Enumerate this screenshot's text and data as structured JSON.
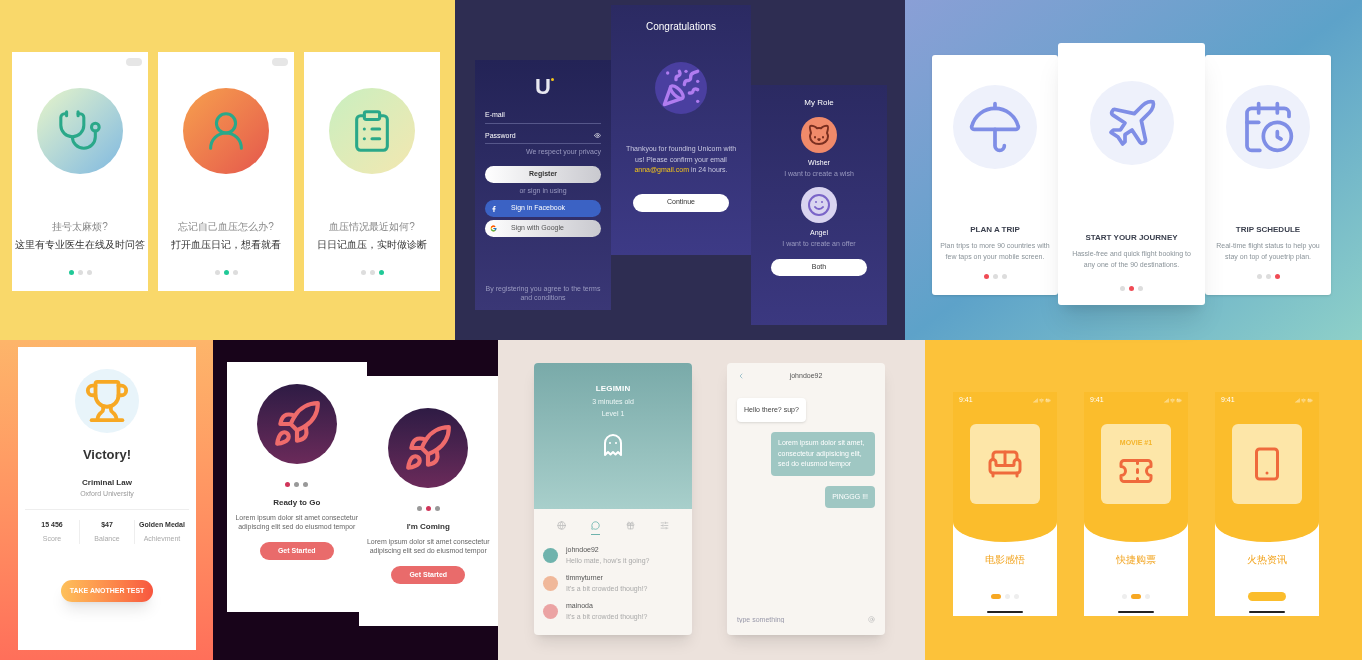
{
  "health": {
    "screens": [
      {
        "skip_button": true,
        "question": "挂号太麻烦?",
        "answer": "这里有专业医生在线及时问答",
        "dots": [
          {
            "selected": true
          },
          {
            "selected": false
          },
          {
            "selected": false
          }
        ]
      },
      {
        "skip_button": true,
        "question": "忘记自己血压怎么办?",
        "answer": "打开血压日记，想看就看",
        "dots": [
          {
            "selected": false
          },
          {
            "selected": true
          },
          {
            "selected": false
          }
        ]
      },
      {
        "skip_button": false,
        "question": "血压情况最近如何?",
        "answer": "日日记血压，实时做诊断",
        "dots": [
          {
            "selected": false
          },
          {
            "selected": false
          },
          {
            "selected": true
          }
        ]
      }
    ]
  },
  "unicorn": {
    "login": {
      "logo": "U",
      "email_label": "E-mail",
      "password_label": "Password",
      "privacy_note": "We respect your privacy",
      "register_button": "Register",
      "alt_sign_in": "or sign in using",
      "facebook_button": "Sign in Facebook",
      "google_button": "Sign with Google",
      "terms": "By registering you agree to the terms and conditions"
    },
    "congrats": {
      "title": "Congratulations",
      "message": "Thankyou for founding Unicorn with us! Please confirm your email",
      "email": "anna@gmail.com",
      "deadline": "in 24 hours.",
      "continue_button": "Continue"
    },
    "role": {
      "title": "My Role",
      "roles": [
        {
          "name": "Wisher",
          "description": "I want to create a wish"
        },
        {
          "name": "Angel",
          "description": "I want to create an offer"
        }
      ],
      "both_button": "Both"
    }
  },
  "travel": {
    "cards": [
      {
        "featured": false,
        "title": "PLAN A TRIP",
        "description": "Plan trips to more 90 countries with few taps on your mobile screen.",
        "dots": [
          {
            "selected": true
          },
          {
            "selected": false
          },
          {
            "selected": false
          }
        ]
      },
      {
        "featured": true,
        "title": "START YOUR JOURNEY",
        "description": "Hassle-free and quick flight booking to any one of the 90 destinations.",
        "dots": [
          {
            "selected": false
          },
          {
            "selected": true
          },
          {
            "selected": false
          }
        ]
      },
      {
        "featured": false,
        "title": "TRIP SCHEDULE",
        "description": "Real-time flight status to help you stay on top of youetrip plan.",
        "dots": [
          {
            "selected": false
          },
          {
            "selected": false
          },
          {
            "selected": true
          }
        ]
      }
    ]
  },
  "victory": {
    "title": "Victory!",
    "course": "Criminal Law",
    "school": "Oxford University",
    "stats": [
      {
        "value": "15 456",
        "label": "Score"
      },
      {
        "value": "$47",
        "label": "Balance"
      },
      {
        "value": "Golden Medal",
        "label": "Achievment"
      }
    ],
    "button": "TAKE ANOTHER TEST"
  },
  "rocket": {
    "screens": [
      {
        "title": "Ready to Go",
        "body": "Lorem ipsum dolor sit amet consectetur adipiscing elit sed do eiusmod tempor",
        "button": "Get Started",
        "dots": [
          {
            "selected": true
          },
          {
            "selected": false
          },
          {
            "selected": false
          }
        ]
      },
      {
        "title": "I'm Coming",
        "body": "Lorem ipsum dolor sit amet consectetur adipiscing elit sed do eiusmod tempor",
        "button": "Get Started",
        "dots": [
          {
            "selected": false
          },
          {
            "selected": true
          },
          {
            "selected": false
          }
        ]
      }
    ]
  },
  "pet": {
    "name": "LEGIMIN",
    "age": "3 minutes old",
    "level_label": "Level 1",
    "tabs": [
      {
        "selected": false
      },
      {
        "selected": true
      },
      {
        "selected": false
      },
      {
        "selected": false
      }
    ],
    "contacts": [
      {
        "name": "johndoe92",
        "preview": "Hello mate, how's it going?",
        "color": "#6fb3ad"
      },
      {
        "name": "timmyturner",
        "preview": "It's a bit crowded though!?",
        "color": "#f0b89a"
      },
      {
        "name": "mainoda",
        "preview": "It's a bit crowded though!?",
        "color": "#eba3a3"
      }
    ]
  },
  "chat": {
    "title": "johndoe92",
    "messages": [
      {
        "kind": "incoming",
        "text": "Hello there? sup?"
      },
      {
        "kind": "outgoing",
        "text": "Lorem ipsum dolor sit amet, consectetur adipisicing elit, sed do eiusmod tempor"
      },
      {
        "kind": "outgoing",
        "text": "PINGGG !!!"
      }
    ],
    "input": {
      "placeholder": "type something"
    }
  },
  "movie": {
    "screens": [
      {
        "time": "9:41",
        "title": "电影感悟",
        "cta_button": false,
        "dots": [
          {
            "selected": true
          },
          {
            "selected": false
          },
          {
            "selected": false
          }
        ]
      },
      {
        "time": "9:41",
        "ticket_text": "MOVIE #1",
        "title": "快捷购票",
        "cta_button": false,
        "dots": [
          {
            "selected": false
          },
          {
            "selected": true
          },
          {
            "selected": false
          }
        ]
      },
      {
        "time": "9:41",
        "title": "火热资讯",
        "cta_button": true
      }
    ]
  }
}
